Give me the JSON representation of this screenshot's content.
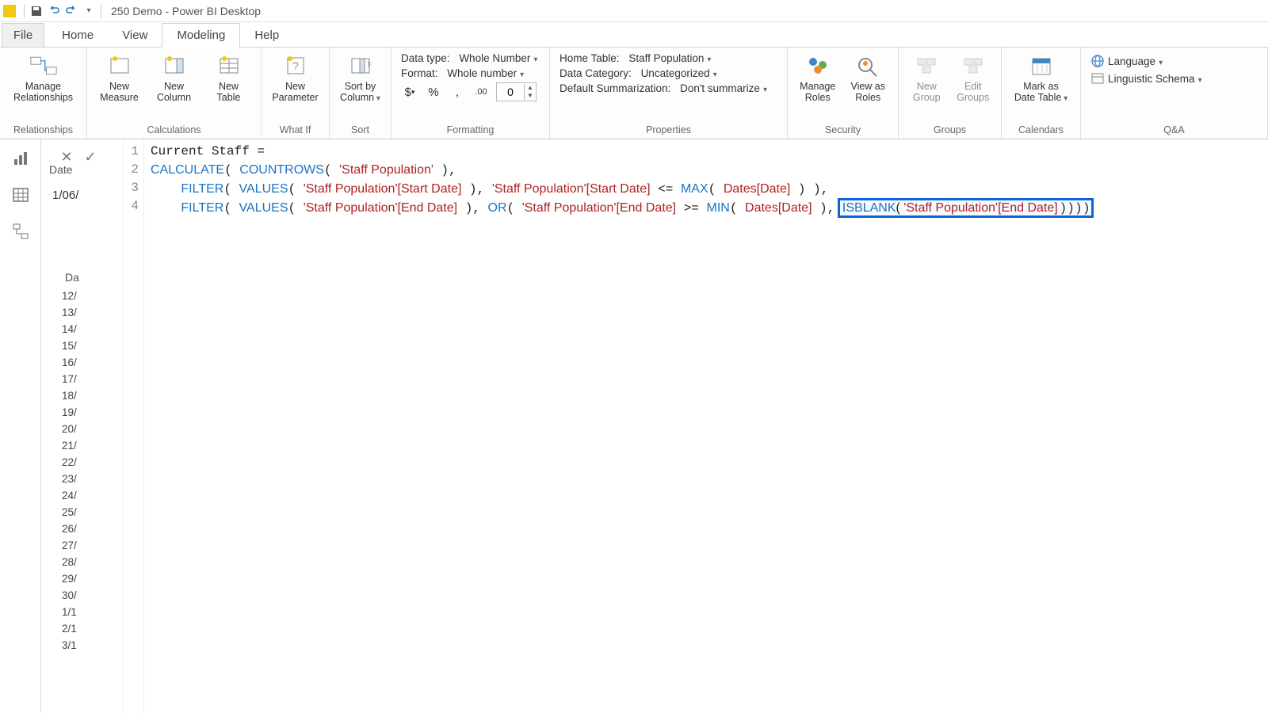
{
  "title": "250 Demo - Power BI Desktop",
  "menu": {
    "file": "File",
    "home": "Home",
    "view": "View",
    "modeling": "Modeling",
    "help": "Help"
  },
  "ribbon": {
    "relationships": {
      "manage": "Manage\nRelationships",
      "group": "Relationships"
    },
    "calculations": {
      "measure": "New\nMeasure",
      "column": "New\nColumn",
      "table": "New\nTable",
      "group": "Calculations"
    },
    "whatif": {
      "param": "New\nParameter",
      "group": "What If"
    },
    "sort": {
      "sortby": "Sort by\nColumn",
      "group": "Sort"
    },
    "formatting": {
      "datatype_label": "Data type:",
      "datatype_value": "Whole Number",
      "format_label": "Format:",
      "format_value": "Whole number",
      "currency": "$",
      "percent": "%",
      "comma": ",",
      "decicon": ".00",
      "decimals": "0",
      "group": "Formatting"
    },
    "properties": {
      "hometable_label": "Home Table:",
      "hometable_value": "Staff Population",
      "category_label": "Data Category:",
      "category_value": "Uncategorized",
      "summ_label": "Default Summarization:",
      "summ_value": "Don't summarize",
      "group": "Properties"
    },
    "security": {
      "manage": "Manage\nRoles",
      "viewas": "View as\nRoles",
      "group": "Security"
    },
    "groups": {
      "new": "New\nGroup",
      "edit": "Edit\nGroups",
      "group": "Groups"
    },
    "calendars": {
      "mark": "Mark as\nDate Table",
      "group": "Calendars"
    },
    "qa": {
      "lang": "Language",
      "schema": "Linguistic Schema",
      "group": "Q&A"
    }
  },
  "formula": {
    "line1": "Current Staff =",
    "line2_calc": "CALCULATE",
    "line2_countrows": "COUNTROWS",
    "line2_tbl": "'Staff Population'",
    "line3_filter": "FILTER",
    "line3_values": "VALUES",
    "line3_col1": "'Staff Population'[Start Date]",
    "line3_col2": "'Staff Population'[Start Date]",
    "line3_max": "MAX",
    "line3_dates": "Dates[Date]",
    "line4_filter": "FILTER",
    "line4_values": "VALUES",
    "line4_col1": "'Staff Population'[End Date]",
    "line4_or": "OR",
    "line4_col2": "'Staff Population'[End Date]",
    "line4_min": "MIN",
    "line4_dates": "Dates[Date]",
    "line4_isblank": "ISBLANK",
    "line4_col3": "'Staff Population'[End Date]"
  },
  "strip": {
    "date_header": "Date",
    "date_value": "1/06/",
    "col2_header": "Da",
    "rows": [
      "12/",
      "13/",
      "14/",
      "15/",
      "16/",
      "17/",
      "18/",
      "19/",
      "20/",
      "21/",
      "22/",
      "23/",
      "24/",
      "25/",
      "26/",
      "27/",
      "28/",
      "29/",
      "30/",
      "1/1",
      "2/1",
      "3/1"
    ]
  }
}
